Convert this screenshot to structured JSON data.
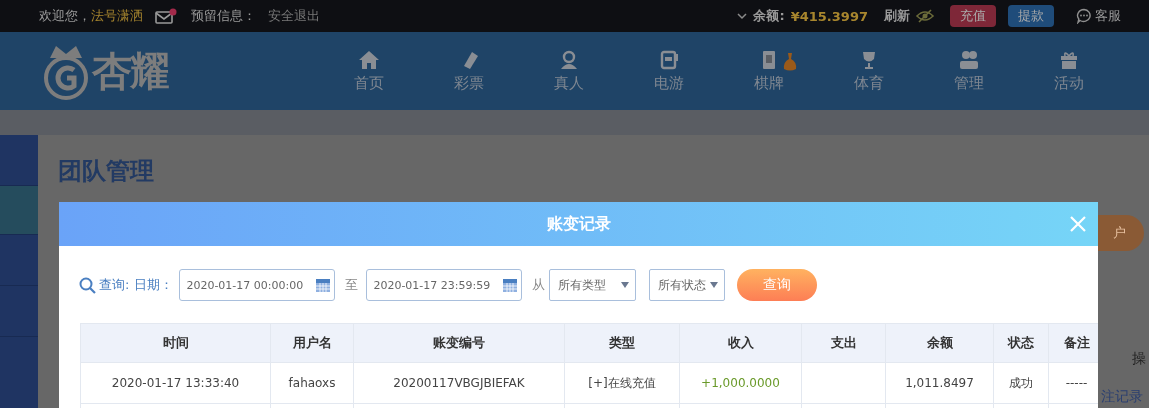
{
  "top_bar": {
    "welcome": "欢迎您，",
    "username": "法号潇洒",
    "has_unread_mail": true,
    "reserved_info": "预留信息：",
    "logout": "安全退出",
    "balance_label": "余额:",
    "balance": "¥415.3997",
    "refresh": "刷新",
    "deposit": "充值",
    "withdraw": "提款",
    "support": "客服"
  },
  "logo": {
    "text": "杏耀"
  },
  "nav": [
    {
      "label": "首页"
    },
    {
      "label": "彩票"
    },
    {
      "label": "真人"
    },
    {
      "label": "电游"
    },
    {
      "label": "棋牌"
    },
    {
      "label": "体育"
    },
    {
      "label": "管理"
    },
    {
      "label": "活动"
    }
  ],
  "sidebar": {
    "items": [
      {
        "selected": false
      },
      {
        "selected": true
      },
      {
        "selected": false
      },
      {
        "selected": false
      }
    ]
  },
  "page": {
    "title": "团队管理",
    "open_account_button": "户",
    "table_header_partial": "操",
    "bet_record_link": "注记录"
  },
  "dialog": {
    "title": "账变记录",
    "query": {
      "label": "查询:",
      "date_label": "日期：",
      "start": "2020-01-17 00:00:00",
      "to": "至",
      "end": "2020-01-17 23:59:59",
      "from": "从",
      "type": "所有类型",
      "status": "所有状态",
      "button": "查询"
    },
    "table": {
      "columns": [
        "时间",
        "用户名",
        "账变编号",
        "类型",
        "收入",
        "支出",
        "余额",
        "状态",
        "备注"
      ],
      "rows": [
        [
          "2020-01-17 13:33:40",
          "fahaoxs",
          "20200117VBGJBIEFAK",
          "[+]在线充值",
          "+1,000.0000",
          "",
          "1,011.8497",
          "成功",
          "-----"
        ]
      ]
    }
  }
}
